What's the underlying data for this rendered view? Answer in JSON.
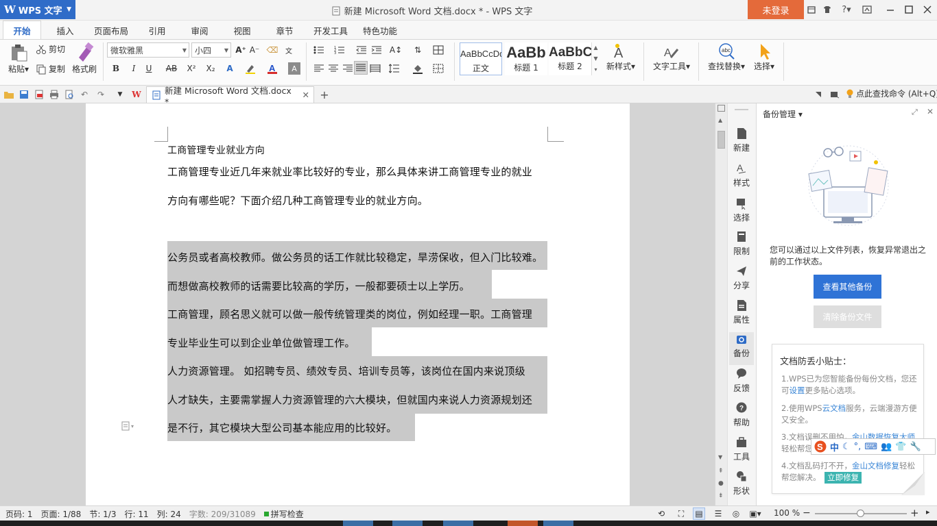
{
  "app": {
    "name": "WPS 文字",
    "window_title": "新建 Microsoft Word 文档.docx * - WPS 文字",
    "login_label": "未登录"
  },
  "menu": {
    "tabs": [
      "开始",
      "插入",
      "页面布局",
      "引用",
      "审阅",
      "视图",
      "章节",
      "开发工具",
      "特色功能"
    ],
    "active": "开始"
  },
  "ribbon": {
    "clipboard": {
      "paste": "粘贴",
      "cut": "剪切",
      "copy": "复制",
      "format_painter": "格式刷"
    },
    "font_name": "微软雅黑",
    "font_size": "小四",
    "styles": [
      {
        "sample": "AaBbCcDd",
        "label": "正文"
      },
      {
        "sample": "AaBb",
        "label": "标题 1"
      },
      {
        "sample": "AaBbC",
        "label": "标题 2"
      }
    ],
    "new_style": "新样式",
    "text_tools": "文字工具",
    "find_replace": "查找替换",
    "select": "选择"
  },
  "quickbar": {
    "doc_tab_title": "新建 Microsoft Word 文档.docx *",
    "search_command": "点此查找命令 (Alt+Q)"
  },
  "document": {
    "lines": [
      "工商管理专业就业方向",
      "工商管理专业近几年来就业率比较好的专业，那么具体来讲工商管理专业的就业",
      "方向有哪些呢？下面介绍几种工商管理专业的就业方向。",
      "公务员或者高校教师。做公务员的话工作就比较稳定，旱涝保收，但入门比较难。",
      "而想做高校教师的话需要比较高的学历，一般都要硕士以上学历。",
      "工商管理，顾名思义就可以做一般传统管理类的岗位，例如经理一职。工商管理",
      "专业毕业生可以到企业单位做管理工作。",
      "人力资源管理。  如招聘专员、绩效专员、培训专员等，该岗位在国内来说顶级",
      "人才缺失，主要需掌握人力资源管理的六大模块，但就国内来说人力资源规划还",
      "是不行，其它模块大型公司基本能应用的比较好。"
    ]
  },
  "sidebar": {
    "items": [
      "新建",
      "样式",
      "选择",
      "限制",
      "分享",
      "属性",
      "备份",
      "反馈",
      "帮助",
      "工具",
      "形状"
    ],
    "active": "备份"
  },
  "panel": {
    "title": "备份管理",
    "description": "您可以通过以上文件列表，恢复异常退出之前的工作状态。",
    "view_backup_btn": "查看其他备份",
    "clear_backup_btn": "清除备份文件",
    "tips_title": "文档防丢小贴士：",
    "tip1_a": "1.WPS已为您智能备份每份文档，您还可",
    "tip1_link": "设置",
    "tip1_b": "更多贴心选项。",
    "tip2_a": "2.使用WPS",
    "tip2_link": "云文档",
    "tip2_b": "服务，云端漫游方便又安全。",
    "tip3_a": "3.文档误删不用怕，",
    "tip3_link": "金山数据恢复大师",
    "tip3_b": "轻松帮您找回。",
    "tip4_a": "4.文档乱码打不开，",
    "tip4_link": "金山文档修复",
    "tip4_b": "轻松帮您解决。",
    "fix_now_btn": "立即修复"
  },
  "statusbar": {
    "page_code": "页码: 1",
    "page": "页面: 1/88",
    "section": "节: 1/3",
    "row": "行: 11",
    "col": "列: 24",
    "word_count": "字数: 209/31089",
    "spell_check": "拼写检查",
    "zoom": "100 %"
  },
  "ime": {
    "mode": "中"
  },
  "colors": {
    "accent": "#2f6cc8",
    "login": "#e46a3a",
    "selection": "#c9c9c9",
    "link": "#3a86d6",
    "fix_button": "#3cb4b0"
  }
}
